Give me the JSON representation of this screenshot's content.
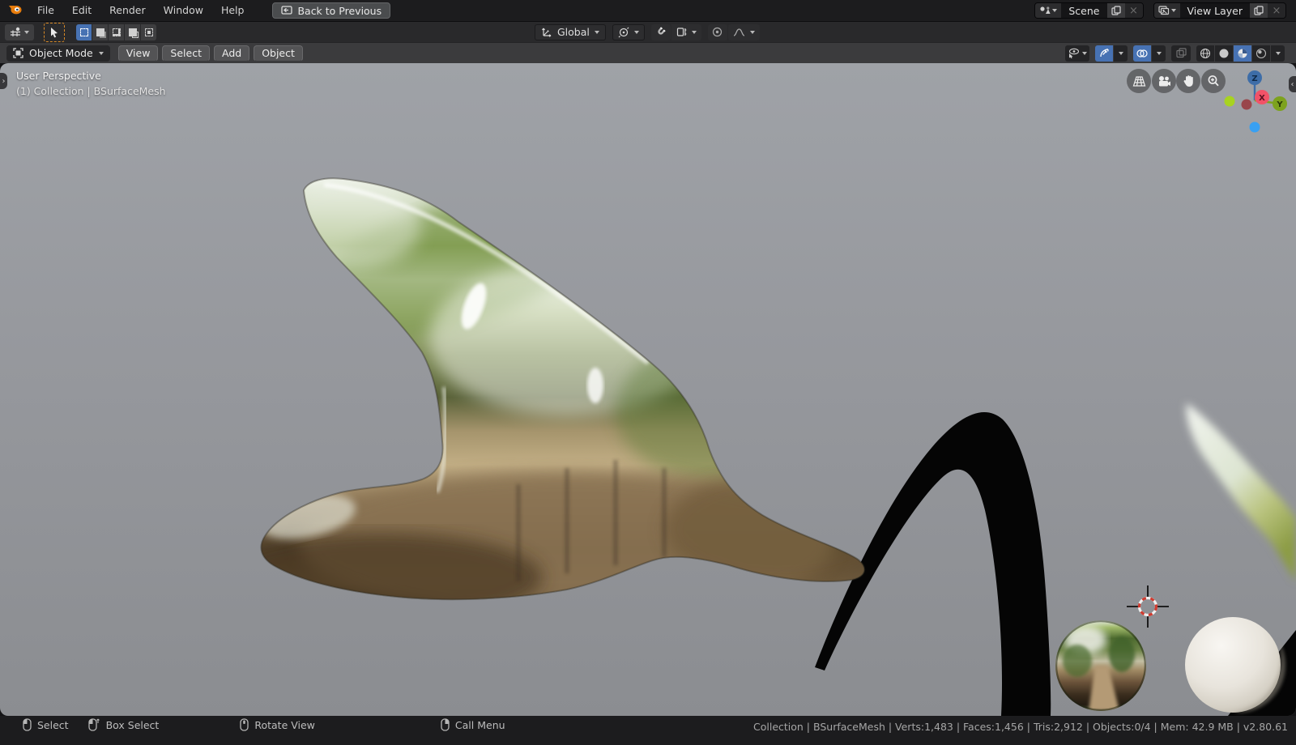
{
  "topbar": {
    "menus": [
      "File",
      "Edit",
      "Render",
      "Window",
      "Help"
    ],
    "back_button": "Back to Previous",
    "scene": {
      "label": "Scene"
    },
    "view_layer": {
      "label": "View Layer"
    }
  },
  "tool_settings": {
    "orientation": "Global"
  },
  "viewport_header": {
    "mode": "Object Mode",
    "menus": [
      "View",
      "Select",
      "Add",
      "Object"
    ]
  },
  "viewport": {
    "perspective_label": "User Perspective",
    "breadcrumb": "(1) Collection | BSurfaceMesh",
    "gizmo_axes": {
      "x": "X",
      "y": "Y",
      "z": "Z"
    }
  },
  "statusbar": {
    "hints": [
      {
        "icon": "mouse-left-icon",
        "label": "Select"
      },
      {
        "icon": "mouse-drag-icon",
        "label": "Box Select"
      },
      {
        "icon": "mouse-middle-icon",
        "label": "Rotate View"
      },
      {
        "icon": "mouse-right-icon",
        "label": "Call Menu"
      }
    ],
    "stats": "Collection | BSurfaceMesh | Verts:1,483 | Faces:1,456 | Tris:2,912 | Objects:0/4 | Mem: 42.9 MB | v2.80.61"
  },
  "colors": {
    "accent_blue": "#4772b3",
    "tool_outline_orange": "#d98a26",
    "axis_x": "#f25268",
    "axis_y": "#7da21e",
    "axis_z": "#3d6da8"
  }
}
